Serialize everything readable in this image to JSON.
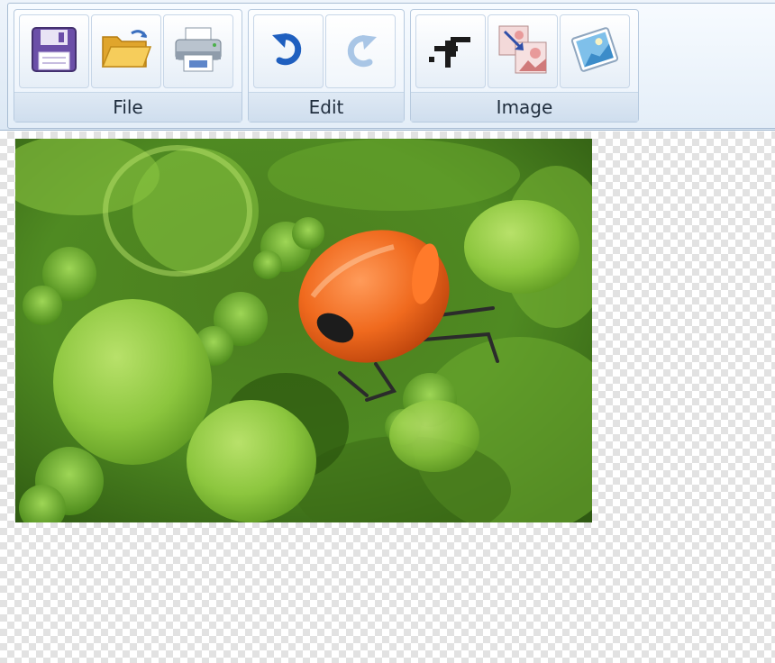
{
  "ribbon": {
    "groups": [
      {
        "label": "File",
        "buttons": [
          "save-icon",
          "open-folder-icon",
          "print-icon"
        ]
      },
      {
        "label": "Edit",
        "buttons": [
          "undo-icon",
          "redo-icon"
        ]
      },
      {
        "label": "Image",
        "buttons": [
          "crop-icon",
          "resize-icon",
          "image-adjust-icon"
        ]
      }
    ]
  },
  "colors": {
    "ribbon_bg": "#dce8f4",
    "undo_blue": "#1f5fbf",
    "redo_disabled": "#a9c6e6",
    "save_purple": "#6b4fa8",
    "folder_yellow": "#f2c14e"
  }
}
